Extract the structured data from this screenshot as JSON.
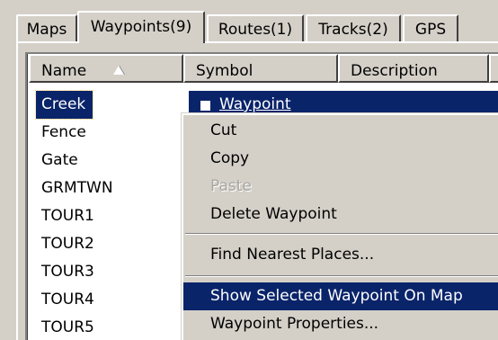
{
  "tabs": [
    {
      "label": "Maps"
    },
    {
      "label": "Waypoints(9)"
    },
    {
      "label": "Routes(1)"
    },
    {
      "label": "Tracks(2)"
    },
    {
      "label": "GPS"
    }
  ],
  "list": {
    "columns": {
      "name": "Name",
      "symbol": "Symbol",
      "description": "Description"
    },
    "rows": [
      {
        "name": "Creek",
        "symbol": "Waypoint"
      },
      {
        "name": "Fence"
      },
      {
        "name": "Gate"
      },
      {
        "name": "GRMTWN"
      },
      {
        "name": "TOUR1"
      },
      {
        "name": "TOUR2"
      },
      {
        "name": "TOUR3"
      },
      {
        "name": "TOUR4"
      },
      {
        "name": "TOUR5"
      }
    ]
  },
  "context_menu": {
    "items": [
      {
        "label": "Cut"
      },
      {
        "label": "Copy"
      },
      {
        "label": "Paste"
      },
      {
        "label": "Delete Waypoint"
      },
      {
        "label": "Find Nearest Places..."
      },
      {
        "label": "Show Selected Waypoint On Map"
      },
      {
        "label": "Waypoint Properties..."
      }
    ]
  },
  "colors": {
    "selection": "#0a246a",
    "face": "#d4d0c8",
    "window": "#ffffff"
  }
}
